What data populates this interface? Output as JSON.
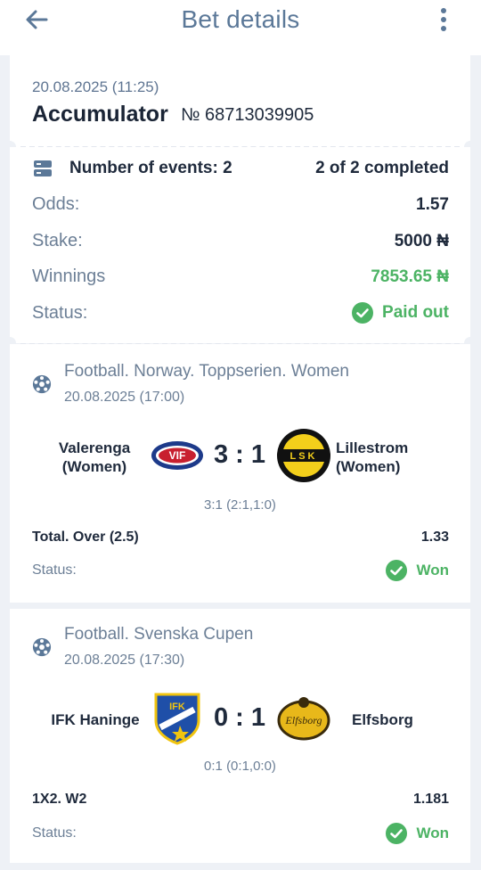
{
  "header": {
    "title": "Bet details"
  },
  "bet": {
    "datetime": "20.08.2025 (11:25)",
    "type": "Accumulator",
    "number": "№ 68713039905"
  },
  "summary": {
    "events_label": "Number of events: 2",
    "completed": "2 of 2 completed",
    "odds_label": "Odds:",
    "odds_value": "1.57",
    "stake_label": "Stake:",
    "stake_value": "5000 ₦",
    "winnings_label": "Winnings",
    "winnings_value": "7853.65 ₦",
    "status_label": "Status:",
    "status_value": "Paid out"
  },
  "events": [
    {
      "league": "Football. Norway. Toppserien. Women",
      "datetime": "20.08.2025 (17:00)",
      "home": "Valerenga\n(Women)",
      "away": "Lillestrom\n(Women)",
      "home_logo_text": "VIF",
      "away_logo_text": "LSK",
      "score": "3 : 1",
      "score_detail": "3:1 (2:1,1:0)",
      "market": "Total. Over (2.5)",
      "odds": "1.33",
      "status_label": "Status:",
      "status_value": "Won"
    },
    {
      "league": "Football. Svenska Cupen",
      "datetime": "20.08.2025 (17:30)",
      "home": "IFK Haninge",
      "away": "Elfsborg",
      "home_logo_text": "IFK",
      "away_logo_text": "Elfsborg",
      "score": "0 : 1",
      "score_detail": "0:1 (0:1,0:0)",
      "market": "1X2. W2",
      "odds": "1.181",
      "status_label": "Status:",
      "status_value": "Won"
    }
  ],
  "icons": {
    "back": "arrow-left-icon",
    "menu": "more-vertical-icon",
    "events": "list-icon",
    "check": "check-circle-icon",
    "sport": "football-icon"
  },
  "colors": {
    "accent": "#5b7898",
    "success": "#4cb364",
    "text": "#1f2a3c",
    "muted": "#6c7f96"
  }
}
